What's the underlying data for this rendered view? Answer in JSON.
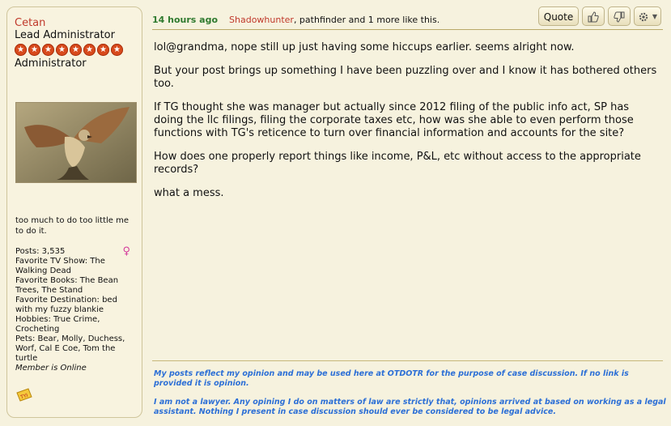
{
  "user": {
    "name": "Cetan",
    "title": "Lead Administrator",
    "group": "Administrator",
    "star_count": 8,
    "tagline": "too much to do too little me to do it.",
    "stats": [
      "Posts: 3,535",
      "Favorite TV Show: The Walking Dead",
      "Favorite Books: The Bean Trees, The Stand",
      "Favorite Destination: bed with my fuzzy blankie",
      "Hobbies: True Crime, Crocheting",
      "Pets: Bear, Molly, Duchess, Worf, Cal E Coe, Tom the turtle"
    ],
    "online_status": "Member is Online",
    "badge": "TYI",
    "gender_icon": "♀"
  },
  "post": {
    "time": "14 hours ago",
    "liker1": "Shadowhunter",
    "likes_rest": ", pathfinder and 1 more like this.",
    "paragraphs": [
      "lol@grandma, nope still up just having some hiccups earlier. seems alright now.",
      "But your post brings up something I have been puzzling over and I know it has bothered others too.",
      "If TG thought she was manager but actually since 2012 filing of the public info act, SP has doing the llc filings, filing the corporate taxes etc, how was she able to even perform those functions with TG's reticence to turn over financial information and accounts for the site?",
      "How does one properly report things like income, P&L, etc without access to the appropriate records?",
      "what a mess."
    ],
    "signature": [
      "My posts reflect my opinion and may be used here at OTDOTR for the purpose of case discussion. If no link is provided it is opinion.",
      "I am not a lawyer. Any opining I do on matters of law are strictly that, opinions arrived at based on working as a legal assistant. Nothing I present in case discussion should ever be considered to be legal advice."
    ]
  },
  "toolbar": {
    "quote_label": "Quote",
    "like_icon": "thumbs-up-icon",
    "dislike_icon": "thumbs-down-icon",
    "options_icon": "gear-icon"
  },
  "colors": {
    "username": "#c0392b",
    "time": "#2f7a2f",
    "signature": "#2c6fd6",
    "background": "#f6f2de"
  }
}
